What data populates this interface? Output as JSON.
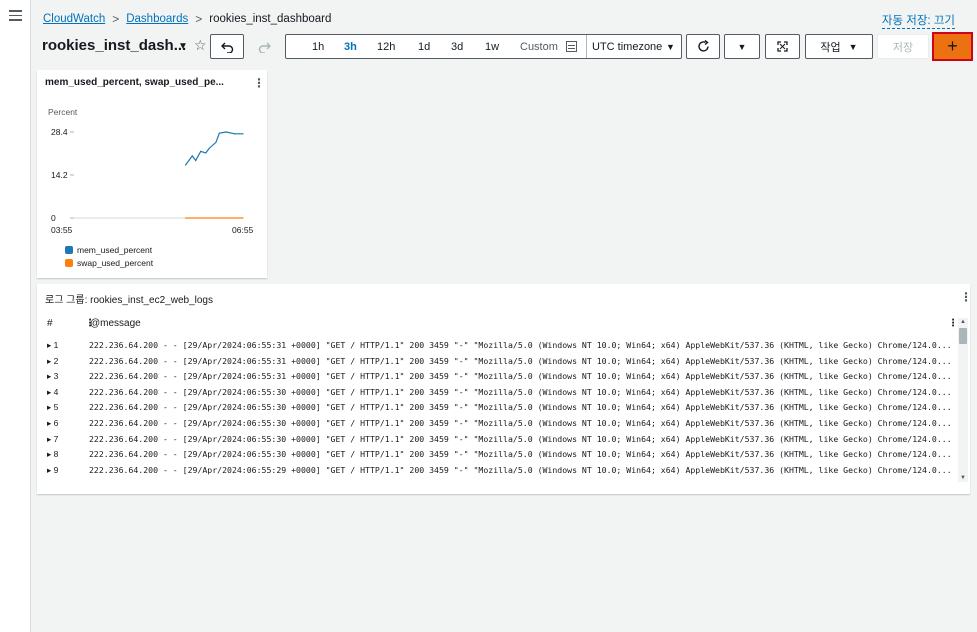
{
  "nav": {
    "menu_icon": "hamburger-icon"
  },
  "breadcrumb": {
    "items": [
      "CloudWatch",
      "Dashboards"
    ],
    "current": "rookies_inst_dashboard"
  },
  "autosave_label": "자동 저장: 끄기",
  "toolbar": {
    "title": "rookies_inst_dash...",
    "undo_icon": "undo-icon",
    "redo_icon": "redo-icon",
    "time_options": [
      "1h",
      "3h",
      "12h",
      "1d",
      "3d",
      "1w"
    ],
    "active_time": "3h",
    "custom_label": "Custom",
    "timezone_label": "UTC timezone",
    "refresh_icon": "refresh-icon",
    "fullscreen_icon": "fullscreen-icon",
    "actions_label": "작업",
    "save_label": "저장",
    "add_label": "+"
  },
  "widget_metrics": {
    "title": "mem_used_percent, swap_used_pe...",
    "menu": "⋮"
  },
  "chart_data": {
    "type": "line",
    "ylabel": "Percent",
    "yticks": [
      "28.4",
      "14.2",
      "0"
    ],
    "xticks": [
      "03:55",
      "06:55"
    ],
    "ylim": [
      0,
      28.4
    ],
    "x_range": [
      "03:55",
      "06:55"
    ],
    "series": [
      {
        "name": "mem_used_percent",
        "color": "#1f77b4",
        "x": [
          0.66,
          0.7,
          0.72,
          0.75,
          0.78,
          0.8,
          0.84,
          0.86,
          0.9,
          0.95,
          1.0
        ],
        "values": [
          17.5,
          20.5,
          19.0,
          22.0,
          21.5,
          23.0,
          25.0,
          28.0,
          28.4,
          27.8,
          27.8
        ]
      },
      {
        "name": "swap_used_percent",
        "color": "#ff7f0e",
        "x": [
          0.66,
          1.0
        ],
        "values": [
          0,
          0
        ]
      }
    ],
    "legend": "bottom",
    "grid": false
  },
  "widget_logs": {
    "title": "로그 그룹: rookies_inst_ec2_web_logs",
    "menu": "⋮",
    "col_num": "#",
    "col_msg": "@message",
    "rows": [
      {
        "num": "1",
        "msg": "222.236.64.200 - - [29/Apr/2024:06:55:31 +0000] \"GET / HTTP/1.1\" 200 3459 \"-\" \"Mozilla/5.0 (Windows NT 10.0; Win64; x64) AppleWebKit/537.36 (KHTML, like Gecko) Chrome/124.0..."
      },
      {
        "num": "2",
        "msg": "222.236.64.200 - - [29/Apr/2024:06:55:31 +0000] \"GET / HTTP/1.1\" 200 3459 \"-\" \"Mozilla/5.0 (Windows NT 10.0; Win64; x64) AppleWebKit/537.36 (KHTML, like Gecko) Chrome/124.0..."
      },
      {
        "num": "3",
        "msg": "222.236.64.200 - - [29/Apr/2024:06:55:31 +0000] \"GET / HTTP/1.1\" 200 3459 \"-\" \"Mozilla/5.0 (Windows NT 10.0; Win64; x64) AppleWebKit/537.36 (KHTML, like Gecko) Chrome/124.0..."
      },
      {
        "num": "4",
        "msg": "222.236.64.200 - - [29/Apr/2024:06:55:30 +0000] \"GET / HTTP/1.1\" 200 3459 \"-\" \"Mozilla/5.0 (Windows NT 10.0; Win64; x64) AppleWebKit/537.36 (KHTML, like Gecko) Chrome/124.0..."
      },
      {
        "num": "5",
        "msg": "222.236.64.200 - - [29/Apr/2024:06:55:30 +0000] \"GET / HTTP/1.1\" 200 3459 \"-\" \"Mozilla/5.0 (Windows NT 10.0; Win64; x64) AppleWebKit/537.36 (KHTML, like Gecko) Chrome/124.0..."
      },
      {
        "num": "6",
        "msg": "222.236.64.200 - - [29/Apr/2024:06:55:30 +0000] \"GET / HTTP/1.1\" 200 3459 \"-\" \"Mozilla/5.0 (Windows NT 10.0; Win64; x64) AppleWebKit/537.36 (KHTML, like Gecko) Chrome/124.0..."
      },
      {
        "num": "7",
        "msg": "222.236.64.200 - - [29/Apr/2024:06:55:30 +0000] \"GET / HTTP/1.1\" 200 3459 \"-\" \"Mozilla/5.0 (Windows NT 10.0; Win64; x64) AppleWebKit/537.36 (KHTML, like Gecko) Chrome/124.0..."
      },
      {
        "num": "8",
        "msg": "222.236.64.200 - - [29/Apr/2024:06:55:30 +0000] \"GET / HTTP/1.1\" 200 3459 \"-\" \"Mozilla/5.0 (Windows NT 10.0; Win64; x64) AppleWebKit/537.36 (KHTML, like Gecko) Chrome/124.0..."
      },
      {
        "num": "9",
        "msg": "222.236.64.200 - - [29/Apr/2024:06:55:29 +0000] \"GET / HTTP/1.1\" 200 3459 \"-\" \"Mozilla/5.0 (Windows NT 10.0; Win64; x64) AppleWebKit/537.36 (KHTML, like Gecko) Chrome/124.0..."
      }
    ]
  },
  "colors": {
    "link": "#0073bb",
    "primary": "#ec7211",
    "highlight_border": "#d0021b",
    "background": "#f2f3f3"
  }
}
